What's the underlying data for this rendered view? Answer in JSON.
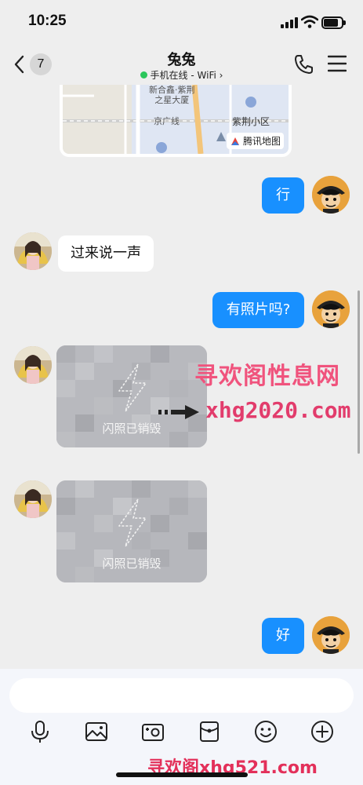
{
  "status_bar": {
    "time": "10:25"
  },
  "header": {
    "unread_count": "7",
    "contact_name": "兔兔",
    "presence": "手机在线 - WiFi",
    "presence_chevron": "›"
  },
  "map_card": {
    "labels": {
      "building": "新合鑫·紫荆\n之星大厦",
      "rail": "京广线",
      "district": "紫荆小区"
    },
    "brand": "腾讯地图"
  },
  "messages": [
    {
      "from": "me",
      "type": "text",
      "text": "行"
    },
    {
      "from": "contact",
      "type": "text",
      "text": "过来说一声"
    },
    {
      "from": "me",
      "type": "text",
      "text": "有照片吗?"
    },
    {
      "from": "contact",
      "type": "flash_photo",
      "text": "闪照已销毁"
    },
    {
      "from": "contact",
      "type": "flash_photo",
      "text": "闪照已销毁"
    },
    {
      "from": "me",
      "type": "text",
      "text": "好"
    }
  ],
  "watermarks": {
    "site_name": "寻欢阁性息网",
    "site_url": "xhg2020.com",
    "bottom": "寻欢阁xhg521.com"
  },
  "composer": {
    "placeholder": ""
  },
  "toolbar": {
    "icons": [
      "microphone-icon",
      "image-icon",
      "camera-icon",
      "red-packet-icon",
      "emoji-icon",
      "plus-icon"
    ]
  },
  "colors": {
    "outgoing_bubble": "#1890ff",
    "incoming_bubble": "#ffffff",
    "online_dot": "#2bc75c",
    "watermark": "#e23c6c",
    "background": "#eeeeee"
  }
}
